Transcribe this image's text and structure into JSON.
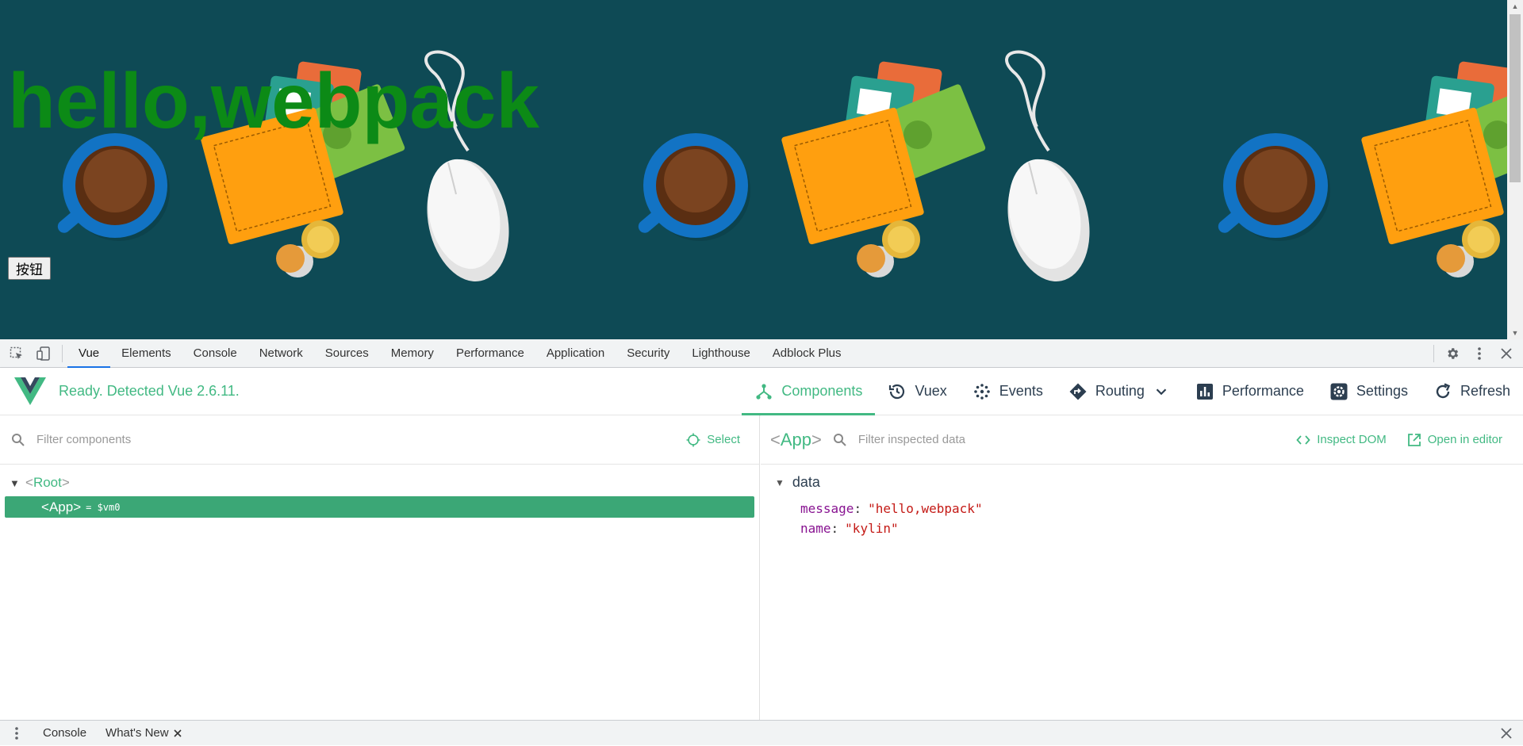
{
  "page": {
    "hero_title": "hello,webpack",
    "button_label": "按钮",
    "background_color": "#0e4a55",
    "title_color": "#0c8a16"
  },
  "devtools": {
    "tabs": [
      "Vue",
      "Elements",
      "Console",
      "Network",
      "Sources",
      "Memory",
      "Performance",
      "Application",
      "Security",
      "Lighthouse",
      "Adblock Plus"
    ],
    "active_tab": "Vue"
  },
  "vue": {
    "status": "Ready. Detected Vue 2.6.11.",
    "brand_color": "#42b983",
    "nav": {
      "components": "Components",
      "vuex": "Vuex",
      "events": "Events",
      "routing": "Routing",
      "performance": "Performance",
      "settings": "Settings",
      "refresh": "Refresh"
    },
    "active_nav": "Components"
  },
  "components_pane": {
    "filter_placeholder": "Filter components",
    "select_label": "Select",
    "tree": {
      "root_name": "Root",
      "child_name": "App",
      "vm_label": "= $vm0"
    }
  },
  "inspector": {
    "component_name": "App",
    "filter_placeholder": "Filter inspected data",
    "inspect_dom": "Inspect DOM",
    "open_in_editor": "Open in editor",
    "section": "data",
    "fields": [
      {
        "key": "message",
        "value": "\"hello,webpack\""
      },
      {
        "key": "name",
        "value": "\"kylin\""
      }
    ]
  },
  "drawer": {
    "tabs": [
      "Console",
      "What's New"
    ]
  }
}
